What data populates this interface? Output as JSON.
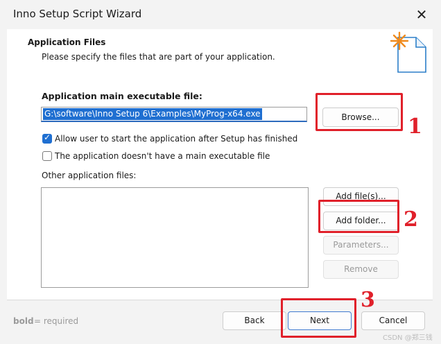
{
  "window": {
    "title": "Inno Setup Script Wizard",
    "close_glyph": "✕"
  },
  "header": {
    "title": "Application Files",
    "subtitle": "Please specify the files that are part of your application."
  },
  "main_exe": {
    "label": "Application main executable file:",
    "value": "G:\\software\\Inno Setup 6\\Examples\\MyProg-x64.exe",
    "browse_label": "Browse..."
  },
  "options": {
    "allow_user": {
      "label": "Allow user to start the application after Setup has finished",
      "checked": true
    },
    "no_main_exe": {
      "label": "The application doesn't have a main executable file",
      "checked": false
    }
  },
  "other_files": {
    "label": "Other application files:",
    "add_files_label": "Add file(s)...",
    "add_folder_label": "Add folder...",
    "parameters_label": "Parameters...",
    "remove_label": "Remove"
  },
  "footer": {
    "required_bold": "bold",
    "required_rest": "= required",
    "back_label": "Back",
    "next_label": "Next",
    "cancel_label": "Cancel"
  },
  "annotations": {
    "n1": "1",
    "n2": "2",
    "n3": "3"
  },
  "watermark": "CSDN @郑三钱",
  "colors": {
    "accent": "#1f6fd1",
    "annotation": "#e0202a"
  }
}
